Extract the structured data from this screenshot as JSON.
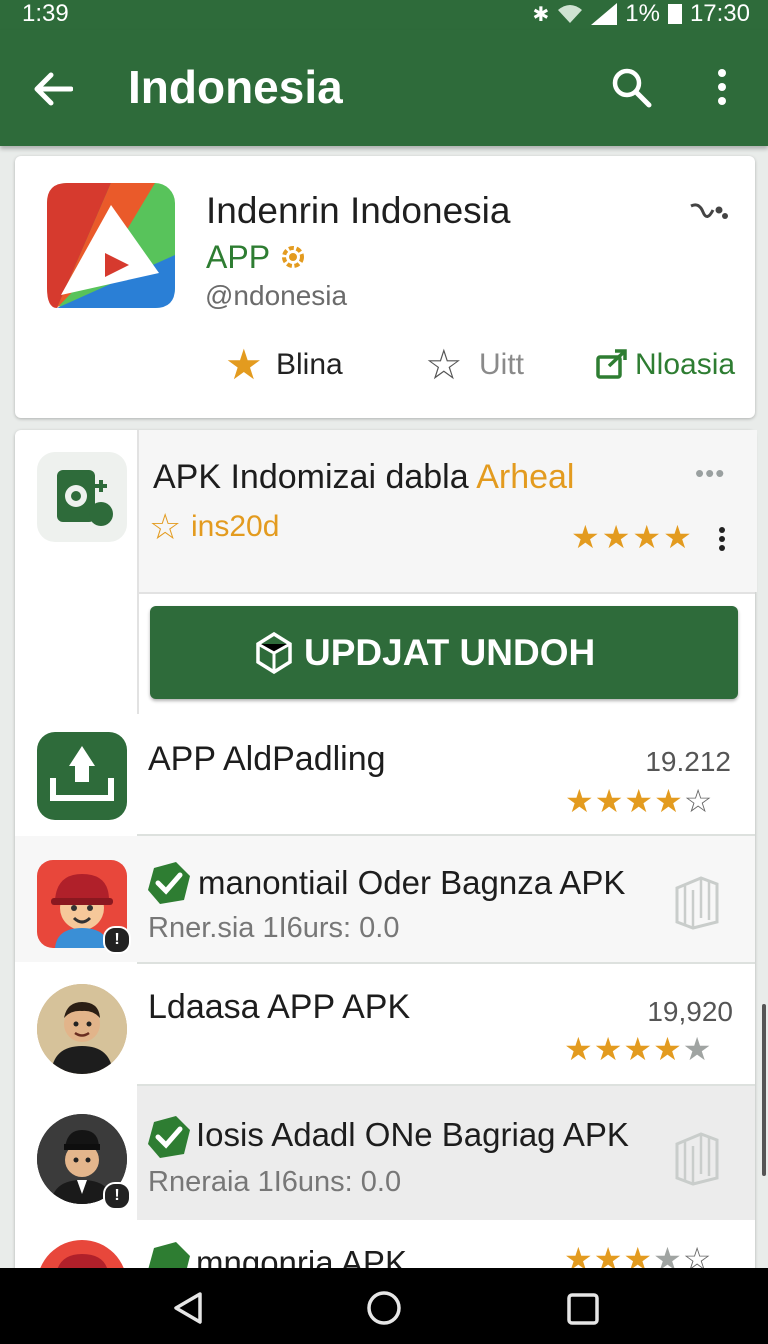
{
  "status": {
    "time": "1:39",
    "battery": "1%",
    "clock": "17:30"
  },
  "appbar": {
    "title": "Indonesia"
  },
  "header_card": {
    "name": "Indenrin Indonesia",
    "type": "APP",
    "handle": "@ndonesia",
    "actions": [
      {
        "label": "Blina"
      },
      {
        "label": "Uitt"
      },
      {
        "label": "Nloasia"
      }
    ]
  },
  "featured": {
    "title_main": "APK Indomizai dabla ",
    "title_accent": "Arheal",
    "subtitle": "ins20d",
    "stars_filled": 4,
    "button": "UPDJAT UNDOH"
  },
  "list": [
    {
      "title": "APP AldPadling",
      "value": "19.212",
      "rating": 4.5
    },
    {
      "title": "manontiail Oder Bagnza APK",
      "sub": "Rner.sia 1I6urs: 0.0"
    },
    {
      "title": "Ldaasa APP APK",
      "value": "19,920",
      "rating": 3.5
    },
    {
      "title": "Iosis Adadl ONe Bagriag APK",
      "sub": "Rneraia 1I6uns: 0.0"
    },
    {
      "title": "mngonria APK"
    }
  ],
  "colors": {
    "primary": "#2e6b3a",
    "accent": "#e39b1f",
    "green_text": "#2e7d32"
  }
}
